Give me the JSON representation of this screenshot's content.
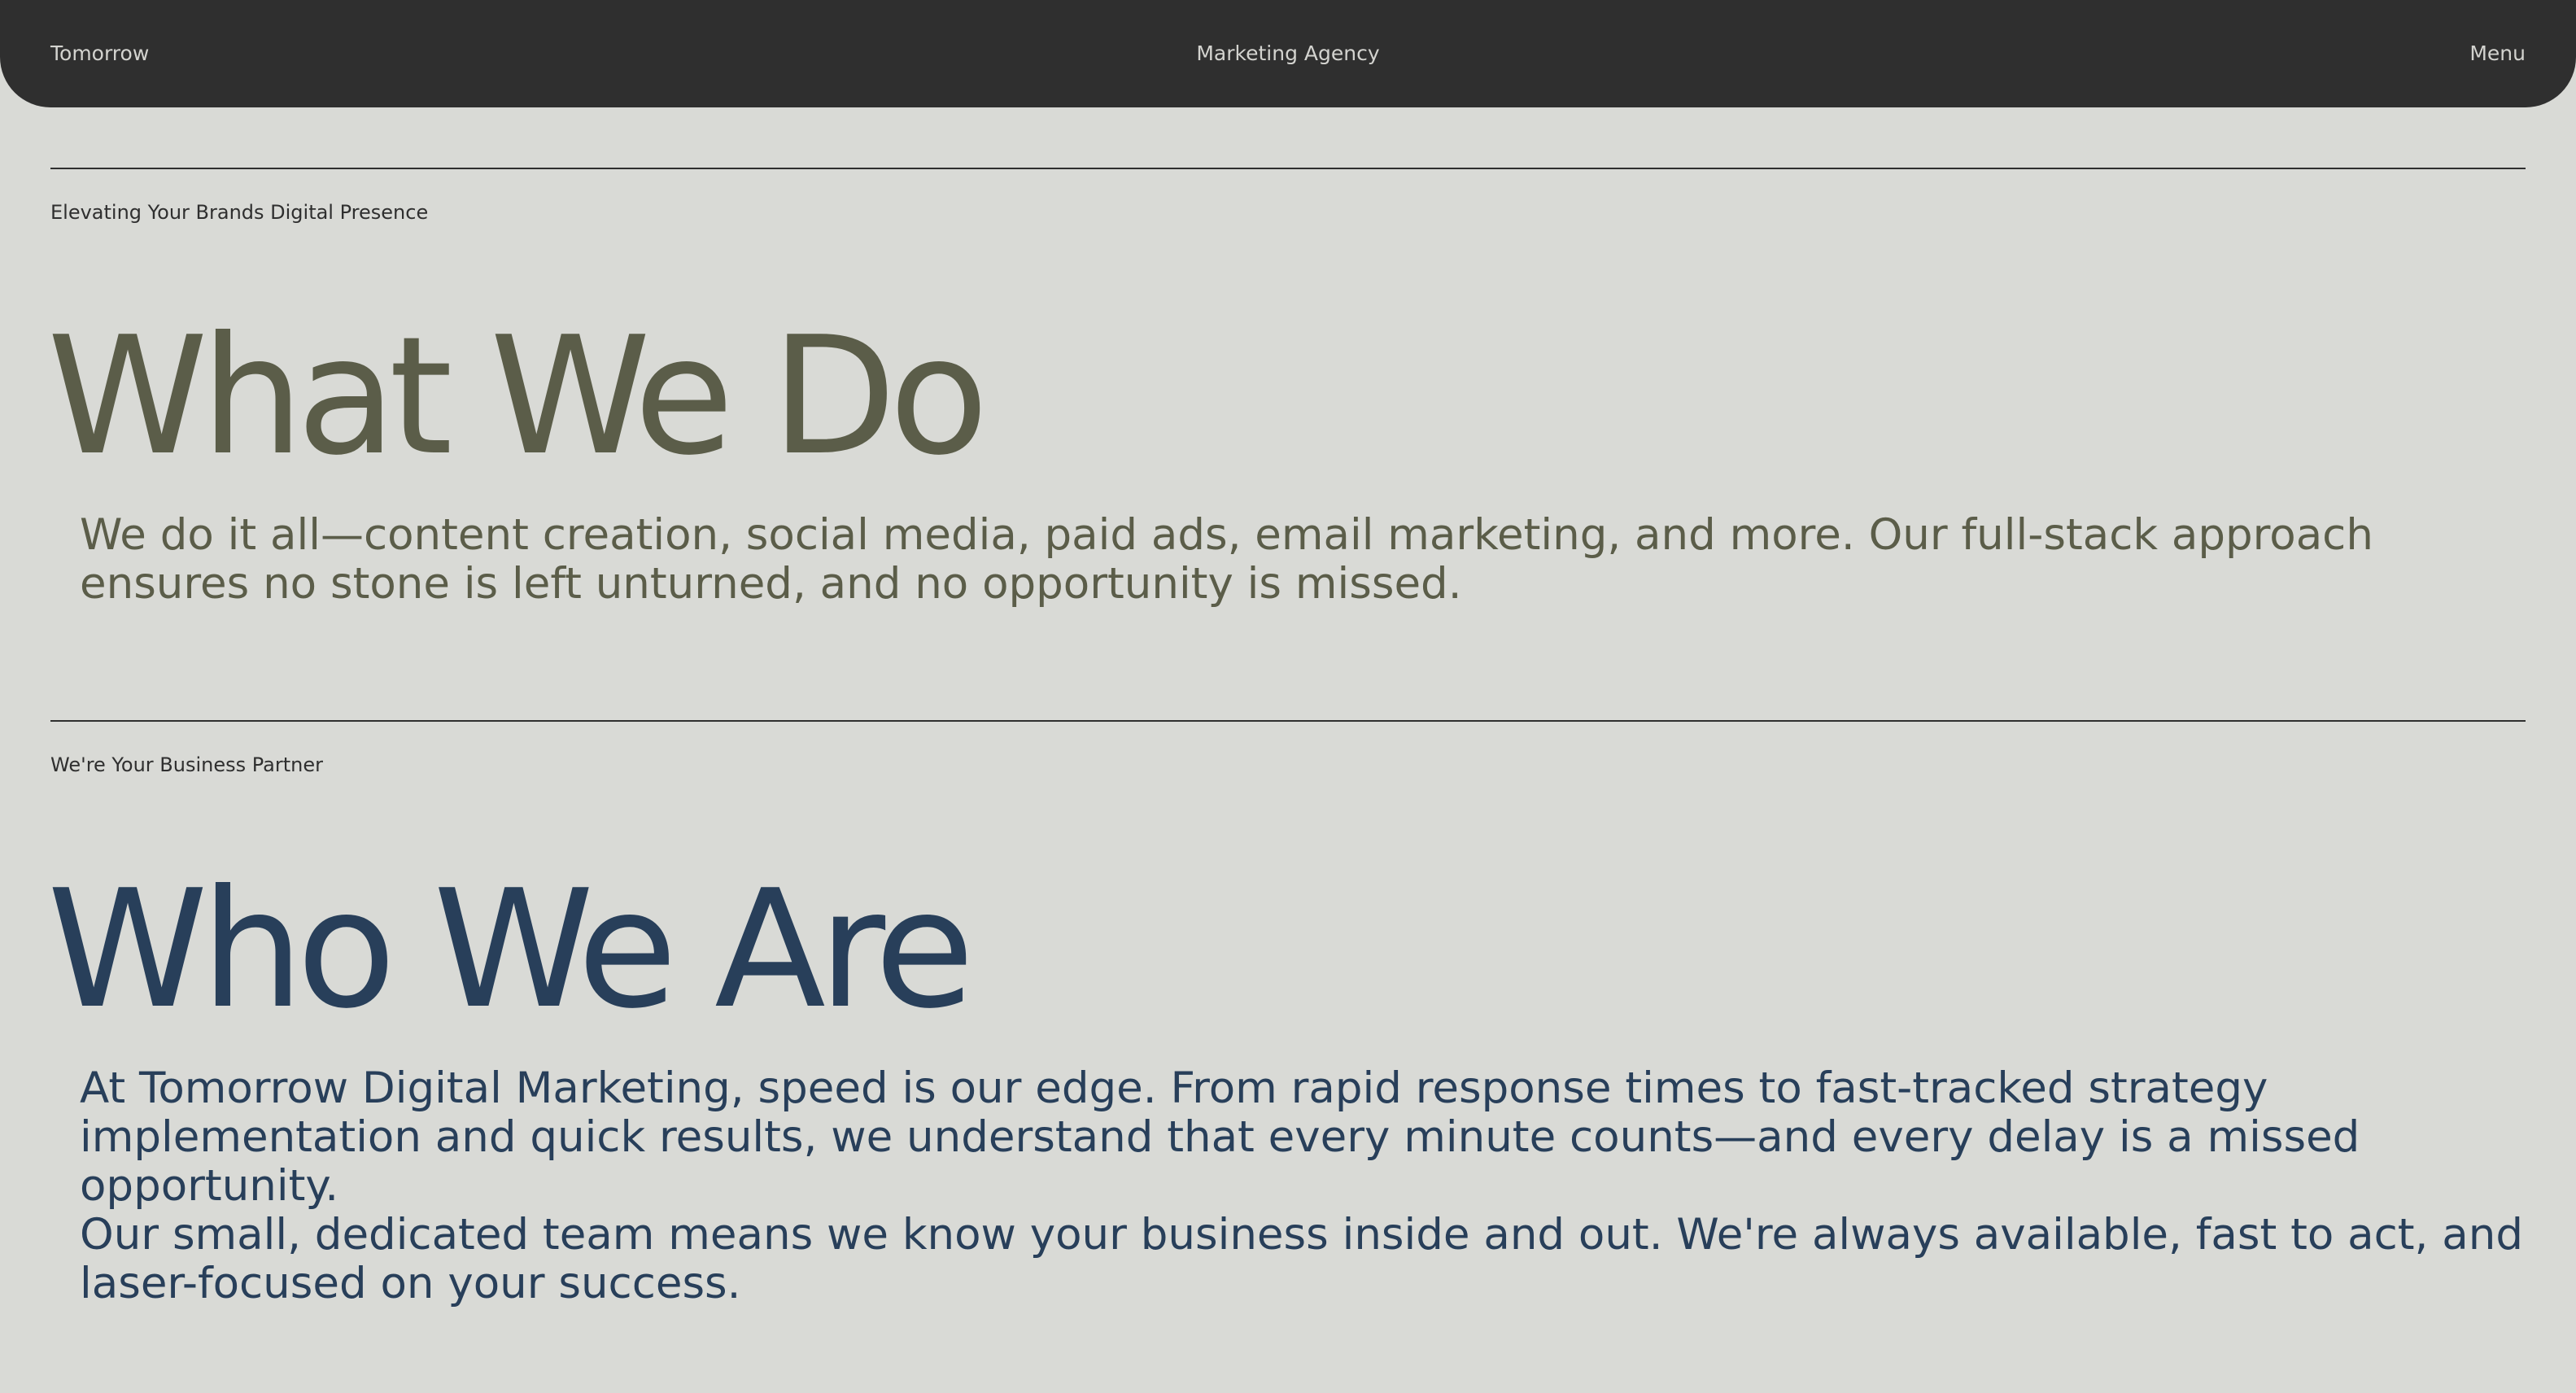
{
  "header": {
    "brand": "Tomorrow",
    "center_title": "Marketing Agency",
    "menu_label": "Menu"
  },
  "sections": [
    {
      "eyebrow": "Elevating Your Brands Digital Presence",
      "title": "What We Do",
      "paragraphs": [
        "We do it all—content creation, social media, paid ads, email marketing, and more. Our full-stack approach ensures no stone is left unturned, and no opportunity is missed."
      ]
    },
    {
      "eyebrow": "We're Your Business Partner",
      "title": "Who We Are",
      "paragraphs": [
        "At Tomorrow Digital Marketing, speed is our edge. From rapid response times to fast-tracked strategy implementation and quick results, we understand that every minute counts—and every delay is a missed opportunity.",
        "Our small, dedicated team means we know your business inside and out. We're always available, fast to act, and laser-focused on your success."
      ]
    }
  ],
  "colors": {
    "header_background": "#2f2f2f",
    "page_background": "#d9dad6",
    "olive_text": "#5b5d49",
    "navy_text": "#283f5a"
  }
}
